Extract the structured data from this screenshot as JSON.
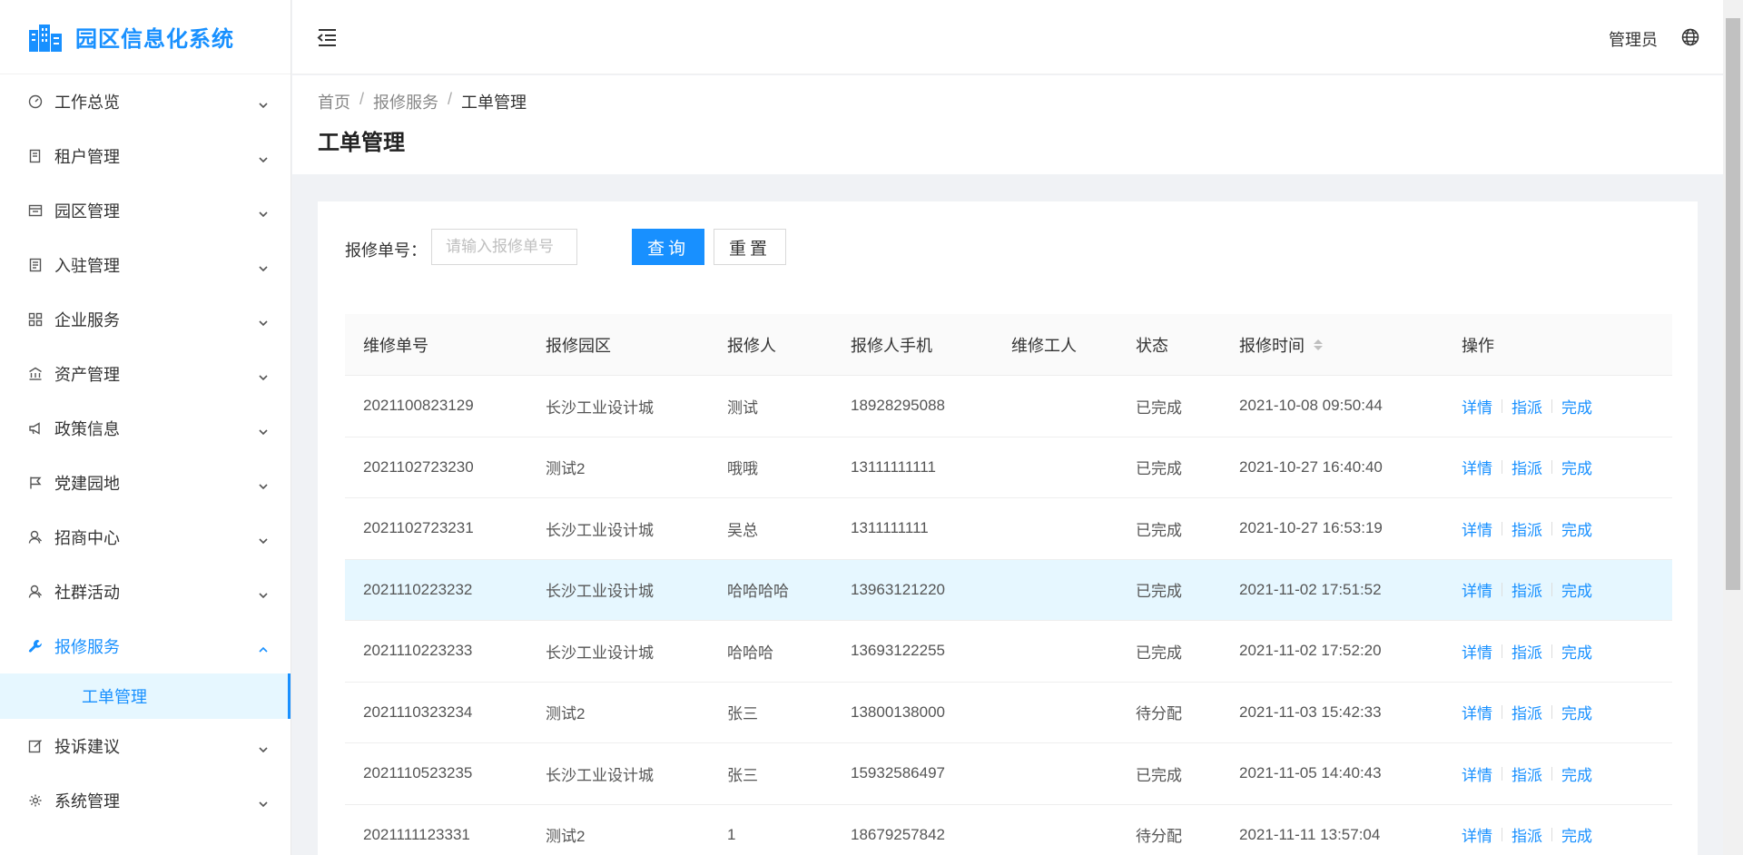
{
  "app": {
    "title": "园区信息化系统"
  },
  "sidebar": {
    "items": [
      {
        "label": "工作总览",
        "icon": "dashboard-icon"
      },
      {
        "label": "租户管理",
        "icon": "tenant-icon"
      },
      {
        "label": "园区管理",
        "icon": "park-icon"
      },
      {
        "label": "入驻管理",
        "icon": "checkin-icon"
      },
      {
        "label": "企业服务",
        "icon": "grid-icon"
      },
      {
        "label": "资产管理",
        "icon": "bank-icon"
      },
      {
        "label": "政策信息",
        "icon": "notification-icon"
      },
      {
        "label": "党建园地",
        "icon": "flag-icon"
      },
      {
        "label": "招商中心",
        "icon": "user-icon"
      },
      {
        "label": "社群活动",
        "icon": "user-icon"
      },
      {
        "label": "报修服务",
        "icon": "wrench-icon"
      },
      {
        "label": "投诉建议",
        "icon": "edit-icon"
      },
      {
        "label": "系统管理",
        "icon": "gear-icon"
      }
    ],
    "submenu": {
      "label": "工单管理"
    }
  },
  "header": {
    "user": "管理员"
  },
  "breadcrumb": {
    "home": "首页",
    "section": "报修服务",
    "current": "工单管理"
  },
  "page": {
    "title": "工单管理"
  },
  "search": {
    "label": "报修单号：",
    "placeholder": "请输入报修单号",
    "query": "查询",
    "reset": "重置"
  },
  "table": {
    "headers": [
      "维修单号",
      "报修园区",
      "报修人",
      "报修人手机",
      "维修工人",
      "状态",
      "报修时间",
      "操作"
    ],
    "actions": {
      "detail": "详情",
      "assign": "指派",
      "complete": "完成"
    },
    "rows": [
      [
        "2021100823129",
        "长沙工业设计城",
        "测试",
        "18928295088",
        "",
        "已完成",
        "2021-10-08 09:50:44"
      ],
      [
        "2021102723230",
        "测试2",
        "哦哦",
        "13111111111",
        "",
        "已完成",
        "2021-10-27 16:40:40"
      ],
      [
        "2021102723231",
        "长沙工业设计城",
        "吴总",
        "1311111111",
        "",
        "已完成",
        "2021-10-27 16:53:19"
      ],
      [
        "2021110223232",
        "长沙工业设计城",
        "哈哈哈哈",
        "13963121220",
        "",
        "已完成",
        "2021-11-02 17:51:52"
      ],
      [
        "2021110223233",
        "长沙工业设计城",
        "哈哈哈",
        "13693122255",
        "",
        "已完成",
        "2021-11-02 17:52:20"
      ],
      [
        "2021110323234",
        "测试2",
        "张三",
        "13800138000",
        "",
        "待分配",
        "2021-11-03 15:42:33"
      ],
      [
        "2021110523235",
        "长沙工业设计城",
        "张三",
        "15932586497",
        "",
        "已完成",
        "2021-11-05 14:40:43"
      ],
      [
        "2021111123331",
        "测试2",
        "1",
        "18679257842",
        "",
        "待分配",
        "2021-11-11 13:57:04"
      ]
    ]
  },
  "colors": {
    "accent": "#1890ff",
    "highlight_row": "#e6f7ff"
  }
}
